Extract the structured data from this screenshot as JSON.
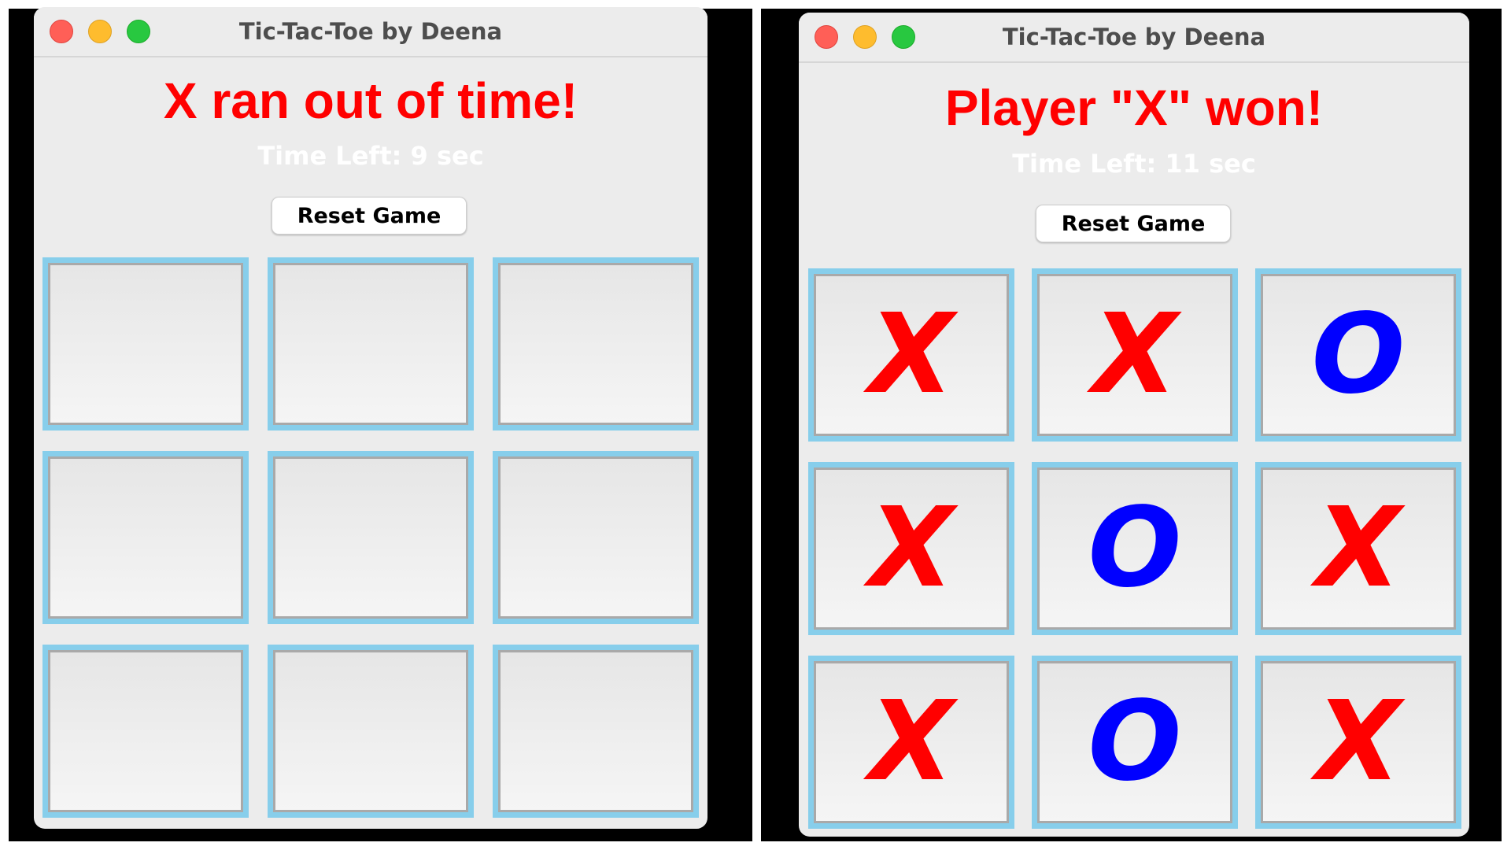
{
  "colors": {
    "status": "#ff0000",
    "timer": "#ffffff",
    "cell_border": "#87ceeb",
    "x_mark": "#ff0000",
    "o_mark": "#0000ff"
  },
  "windows": [
    {
      "title": "Tic-Tac-Toe by Deena",
      "status": "X ran out of time!",
      "timer": "Time Left: 9 sec",
      "reset_label": "Reset Game",
      "board": [
        "",
        "",
        "",
        "",
        "",
        "",
        "",
        "",
        ""
      ]
    },
    {
      "title": "Tic-Tac-Toe by Deena",
      "status": "Player \"X\" won!",
      "timer": "Time Left: 11 sec",
      "reset_label": "Reset Game",
      "board": [
        "X",
        "X",
        "O",
        "X",
        "O",
        "X",
        "X",
        "O",
        "X"
      ]
    }
  ]
}
